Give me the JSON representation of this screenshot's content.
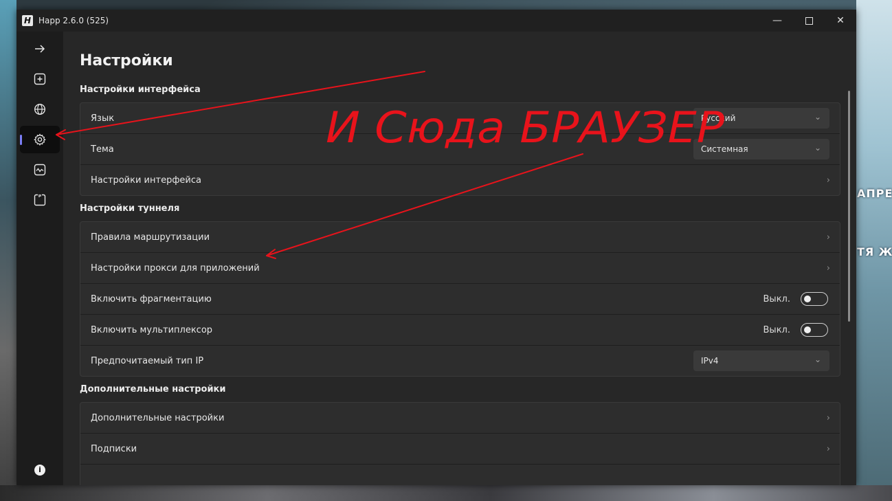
{
  "window": {
    "title": "Happ 2.6.0 (525)",
    "app_icon": "H"
  },
  "desktop_text": [
    "АПРЕТ",
    "ТЯ Ж"
  ],
  "page": {
    "title": "Настройки"
  },
  "sidebar": {
    "items": [
      {
        "icon": "arrow-right-icon"
      },
      {
        "icon": "add-square-icon"
      },
      {
        "icon": "globe-icon"
      },
      {
        "icon": "gear-icon",
        "active": true
      },
      {
        "icon": "activity-icon"
      },
      {
        "icon": "log-icon"
      }
    ],
    "info_label": "i"
  },
  "sections": {
    "interface": {
      "title": "Настройки интерфейса",
      "language_label": "Язык",
      "language_value": "Русский",
      "theme_label": "Тема",
      "theme_value": "Системная",
      "interface_settings_label": "Настройки интерфейса"
    },
    "tunnel": {
      "title": "Настройки туннеля",
      "routing_label": "Правила маршрутизации",
      "app_proxy_label": "Настройки прокси для приложений",
      "fragmentation_label": "Включить фрагментацию",
      "fragmentation_state": "Выкл.",
      "multiplexer_label": "Включить мультиплексор",
      "multiplexer_state": "Выкл.",
      "ip_type_label": "Предпочитаемый тип IP",
      "ip_type_value": "IPv4"
    },
    "additional": {
      "title": "Дополнительные настройки",
      "additional_label": "Дополнительные настройки",
      "subscriptions_label": "Подписки"
    }
  },
  "annotation": {
    "text": "И Сюда БРАУЗЕР",
    "color": "#e8131b"
  },
  "colors": {
    "accent": "#7b7ef5",
    "annotation": "#e8131b"
  }
}
